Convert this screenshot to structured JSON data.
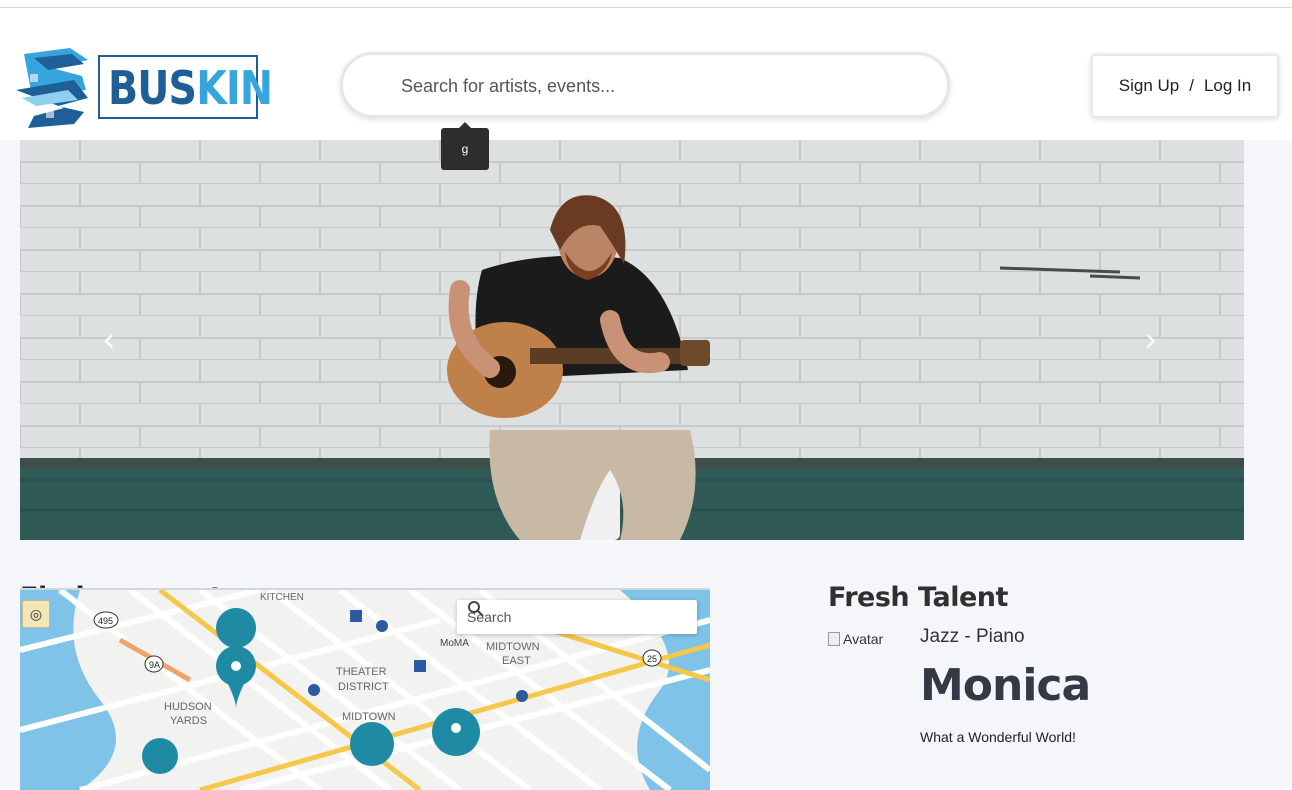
{
  "header": {
    "logo_text_a": "BUS",
    "logo_text_b": "KIN",
    "search_placeholder": "Search for artists, events...",
    "tooltip": "g",
    "sign_up": "Sign Up",
    "separator": "/",
    "log_in": "Log In"
  },
  "carousel": {
    "prev_icon": "chevron-left-icon",
    "next_icon": "chevron-right-icon"
  },
  "events": {
    "title": "Find an event near you",
    "map_search_placeholder": "Search"
  },
  "talent": {
    "title": "Fresh Talent",
    "avatar_alt": "Avatar",
    "genre": "Jazz - Piano",
    "name": "Monica",
    "song": "What a Wonderful World!"
  },
  "colors": {
    "brand_dark": "#1d5f96",
    "brand_light": "#36a4dd",
    "pin": "#1f8aa3"
  }
}
